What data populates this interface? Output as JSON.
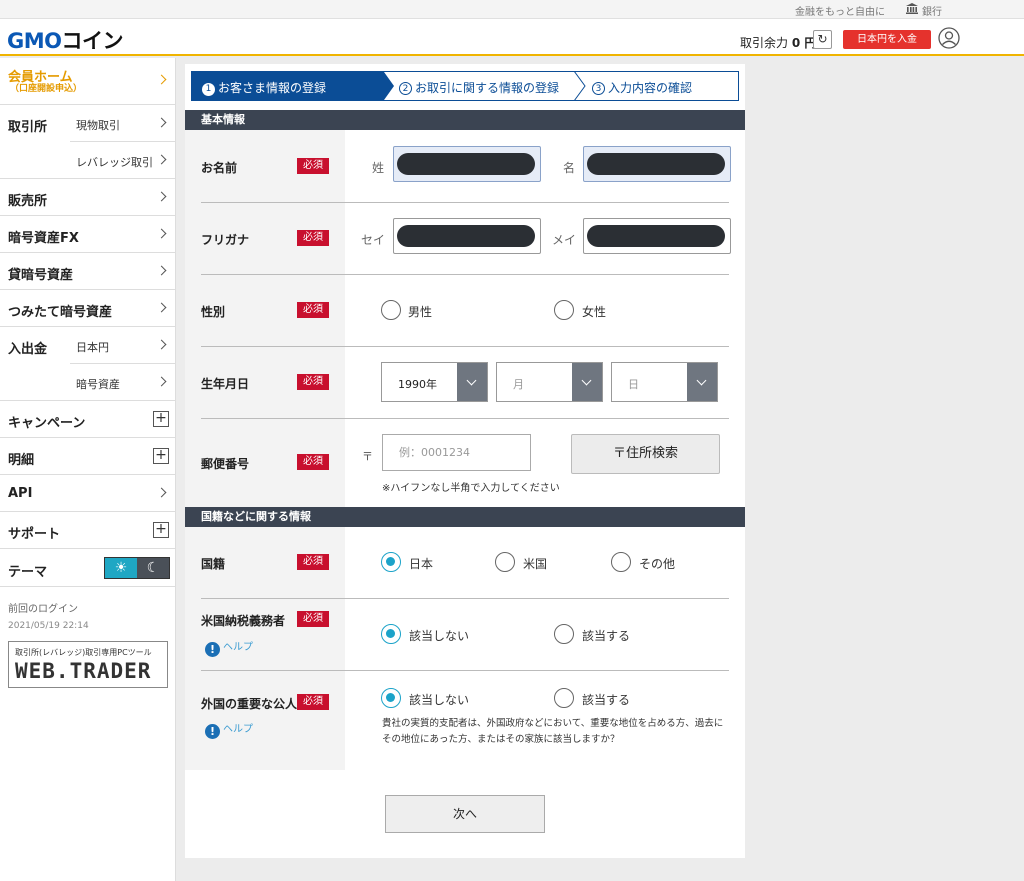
{
  "topbar": {
    "tagline": "金融をもっと自由に",
    "bank_label": "銀行"
  },
  "header": {
    "logo_gmo": "GMO",
    "logo_coin": "コイン",
    "balance_label": "取引余力",
    "balance_value": "0 円",
    "deposit_button": "日本円を入金"
  },
  "sidebar": {
    "member_home": "会員ホーム",
    "member_home_sub": "（口座開設申込）",
    "exchange": "取引所",
    "spot": "現物取引",
    "leverage": "レバレッジ取引",
    "sales": "販売所",
    "crypto_fx": "暗号資産FX",
    "lending": "貸暗号資産",
    "tsumitate": "つみたて暗号資産",
    "deposit_withdraw": "入出金",
    "jpy": "日本円",
    "crypto": "暗号資産",
    "campaign": "キャンペーン",
    "statement": "明細",
    "api": "API",
    "support": "サポート",
    "theme": "テーマ",
    "last_login_label": "前回のログイン",
    "last_login_time": "2021/05/19 22:14",
    "webtrader_sub": "取引所(レバレッジ)取引専用PCツール",
    "webtrader_logo": "WEB.TRADER"
  },
  "steps": [
    {
      "num": "1",
      "label": "お客さま情報の登録"
    },
    {
      "num": "2",
      "label": "お取引に関する情報の登録"
    },
    {
      "num": "3",
      "label": "入力内容の確認"
    }
  ],
  "basic": {
    "section_title": "基本情報",
    "required": "必須",
    "name_label": "お名前",
    "last_name_cap": "姓",
    "first_name_cap": "名",
    "furigana_label": "フリガナ",
    "sei_cap": "セイ",
    "mei_cap": "メイ",
    "gender_label": "性別",
    "male": "男性",
    "female": "女性",
    "birth_label": "生年月日",
    "birth_year": "1990年",
    "birth_month_placeholder": "月",
    "birth_day_placeholder": "日",
    "postal_label": "郵便番号",
    "postal_mark": "〒",
    "postal_placeholder": "例：0001234",
    "postal_note": "※ハイフンなし半角で入力してください",
    "address_search": "〒住所検索"
  },
  "nationality": {
    "section_title": "国籍などに関する情報",
    "country_label": "国籍",
    "japan": "日本",
    "usa": "米国",
    "other": "その他",
    "us_tax_label": "米国納税義務者",
    "help": "ヘルプ",
    "not_applicable": "該当しない",
    "applicable": "該当する",
    "pep_label": "外国の重要な公人",
    "pep_note": "貴社の実質的支配者は、外国政府などにおいて、重要な地位を占める方、過去にその地位にあった方、またはその家族に該当しますか？"
  },
  "next_button": "次へ"
}
